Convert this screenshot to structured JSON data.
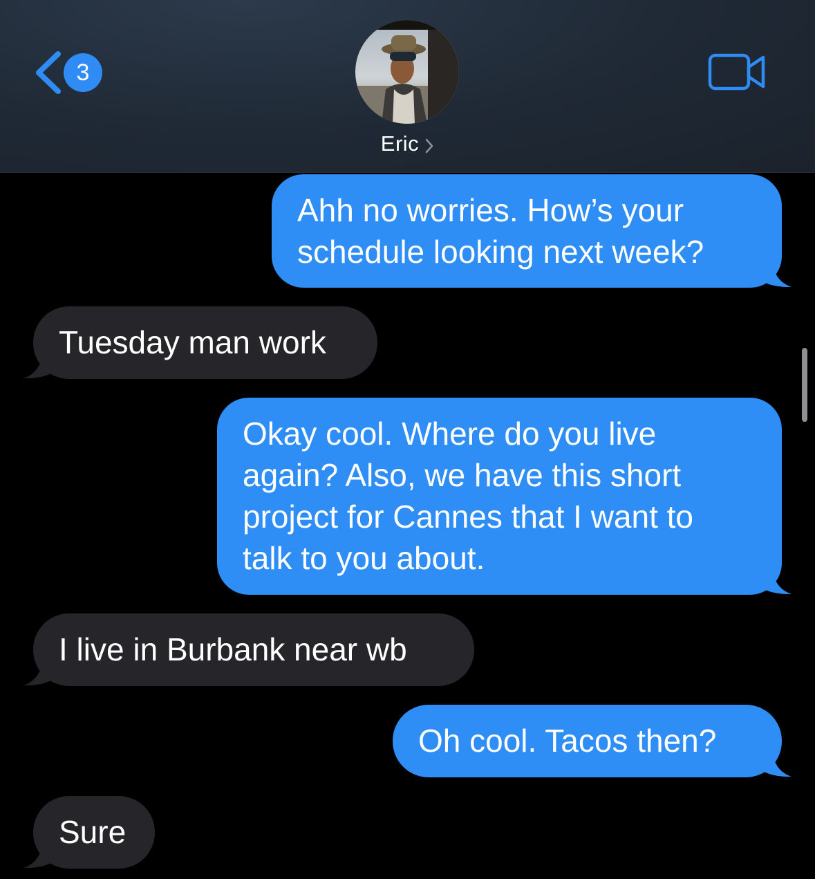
{
  "header": {
    "back_badge_count": "3",
    "contact_name": "Eric"
  },
  "colors": {
    "sent_bubble": "#2f8ef6",
    "received_bubble": "#26262a",
    "accent": "#2f8cf5",
    "background": "#000000"
  },
  "icons": {
    "back": "chevron-left-icon",
    "contact_details": "chevron-right-icon",
    "video_call": "video-camera-icon"
  },
  "messages": [
    {
      "direction": "sent",
      "text": "Ahh no worries. How’s your\nschedule looking next week?"
    },
    {
      "direction": "received",
      "text": "Tuesday man work"
    },
    {
      "direction": "sent",
      "text": "Okay cool. Where do you live\nagain? Also, we have this short\nproject for Cannes that I want to\ntalk to you about."
    },
    {
      "direction": "received",
      "text": "I live in Burbank near wb"
    },
    {
      "direction": "sent",
      "text": "Oh cool. Tacos then?"
    },
    {
      "direction": "received",
      "text": "Sure"
    }
  ]
}
